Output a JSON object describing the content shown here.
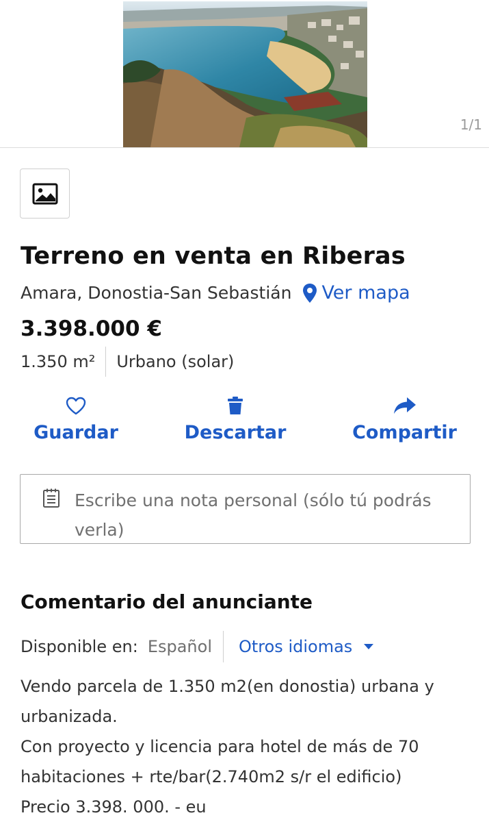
{
  "gallery": {
    "counter": "1/1"
  },
  "listing": {
    "title": "Terreno en venta en Riberas",
    "location": "Amara, Donostia-San Sebastián",
    "map_link": "Ver mapa",
    "price": "3.398.000 €",
    "features": [
      "1.350 m²",
      "Urbano (solar)"
    ]
  },
  "actions": {
    "save": "Guardar",
    "discard": "Descartar",
    "share": "Compartir"
  },
  "note": {
    "placeholder": "Escribe una nota personal (sólo tú podrás verla)"
  },
  "comment": {
    "title": "Comentario del anunciante",
    "available_label": "Disponible en:",
    "current_language": "Español",
    "other_languages": "Otros idiomas",
    "lines": [
      "Vendo parcela de 1.350 m2(en donostia) urbana y urbanizada.",
      "Con proyecto y licencia para hotel de más de 70 habitaciones + rte/bar(2.740m2 s/r el edificio)",
      "Precio 3.398. 000. - eu"
    ]
  },
  "colors": {
    "accent": "#1e5bc6",
    "text": "#111111",
    "muted": "#707070",
    "border": "#cfcfcf"
  }
}
